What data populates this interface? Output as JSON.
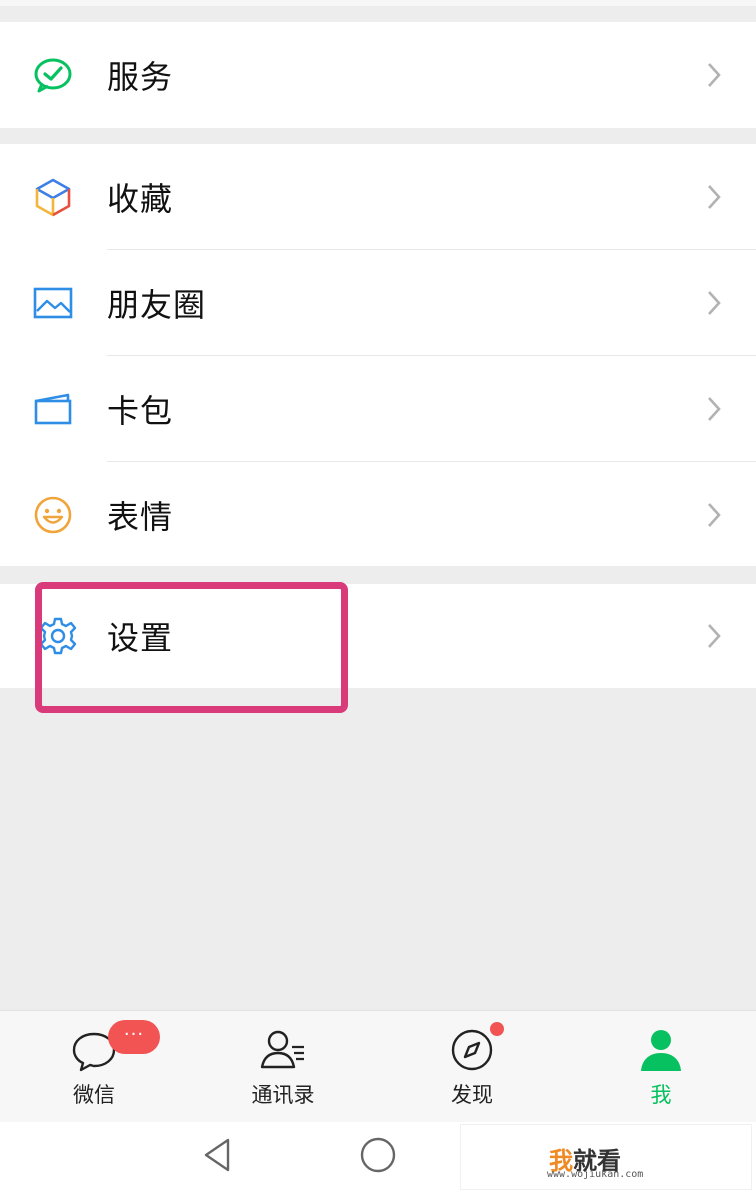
{
  "menu": {
    "services": {
      "label": "服务",
      "icon": "wechat-pay-icon"
    },
    "favorites": {
      "label": "收藏",
      "icon": "cube-icon"
    },
    "moments": {
      "label": "朋友圈",
      "icon": "picture-icon"
    },
    "cards": {
      "label": "卡包",
      "icon": "card-wallet-icon"
    },
    "stickers": {
      "label": "表情",
      "icon": "smiley-icon"
    },
    "settings": {
      "label": "设置",
      "icon": "gear-icon"
    }
  },
  "tabbar": {
    "chats": {
      "label": "微信",
      "badge": "···"
    },
    "contacts": {
      "label": "通讯录"
    },
    "discover": {
      "label": "发现"
    },
    "me": {
      "label": "我",
      "active": true
    }
  },
  "colors": {
    "accent_green": "#07c160",
    "highlight_border": "#d93a7a",
    "badge_red": "#f25454"
  },
  "watermark": {
    "glyph": "我",
    "text": "就看",
    "url": "www.wojiukan.com"
  }
}
